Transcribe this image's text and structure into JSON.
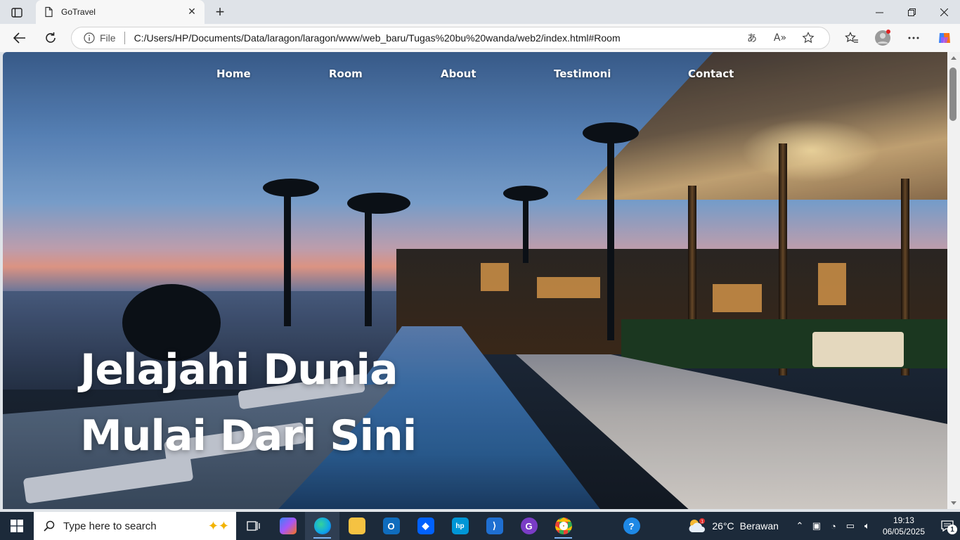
{
  "browser": {
    "tab_title": "GoTravel",
    "new_tab_symbol": "+",
    "address_prefix": "File",
    "url": "C:/Users/HP/Documents/Data/laragon/laragon/www/web_baru/Tugas%20bu%20wanda/web2/index.html#Room",
    "icons": [
      "tab-actions-icon",
      "page-icon",
      "close-icon",
      "new-tab-icon",
      "minimize-icon",
      "maximize-icon",
      "window-close-icon",
      "back-icon",
      "refresh-icon",
      "info-icon",
      "translate-icon",
      "read-aloud-icon",
      "favorite-star-icon",
      "favorites-icon",
      "profile-icon",
      "more-icon",
      "copilot-icon"
    ]
  },
  "site": {
    "nav": [
      "Home",
      "Room",
      "About",
      "Testimoni",
      "Contact"
    ],
    "headline_line1": "Jelajahi Dunia",
    "headline_line2": "Mulai Dari Sini"
  },
  "taskbar": {
    "search_placeholder": "Type here to search",
    "apps": [
      "task-view",
      "copilot",
      "edge",
      "file-explorer",
      "outlook",
      "dropbox",
      "hp-smart",
      "vscode",
      "github-desktop",
      "chrome",
      "help"
    ],
    "weather_temp": "26°C",
    "weather_condition": "Berawan",
    "weather_badge": "1",
    "time": "19:13",
    "date": "06/05/2025",
    "notification_count": "1"
  },
  "colors": {
    "taskbar_bg": "#1c2a3a",
    "chrome_bg": "#dfe3e8",
    "nav_text": "#ffffff"
  }
}
